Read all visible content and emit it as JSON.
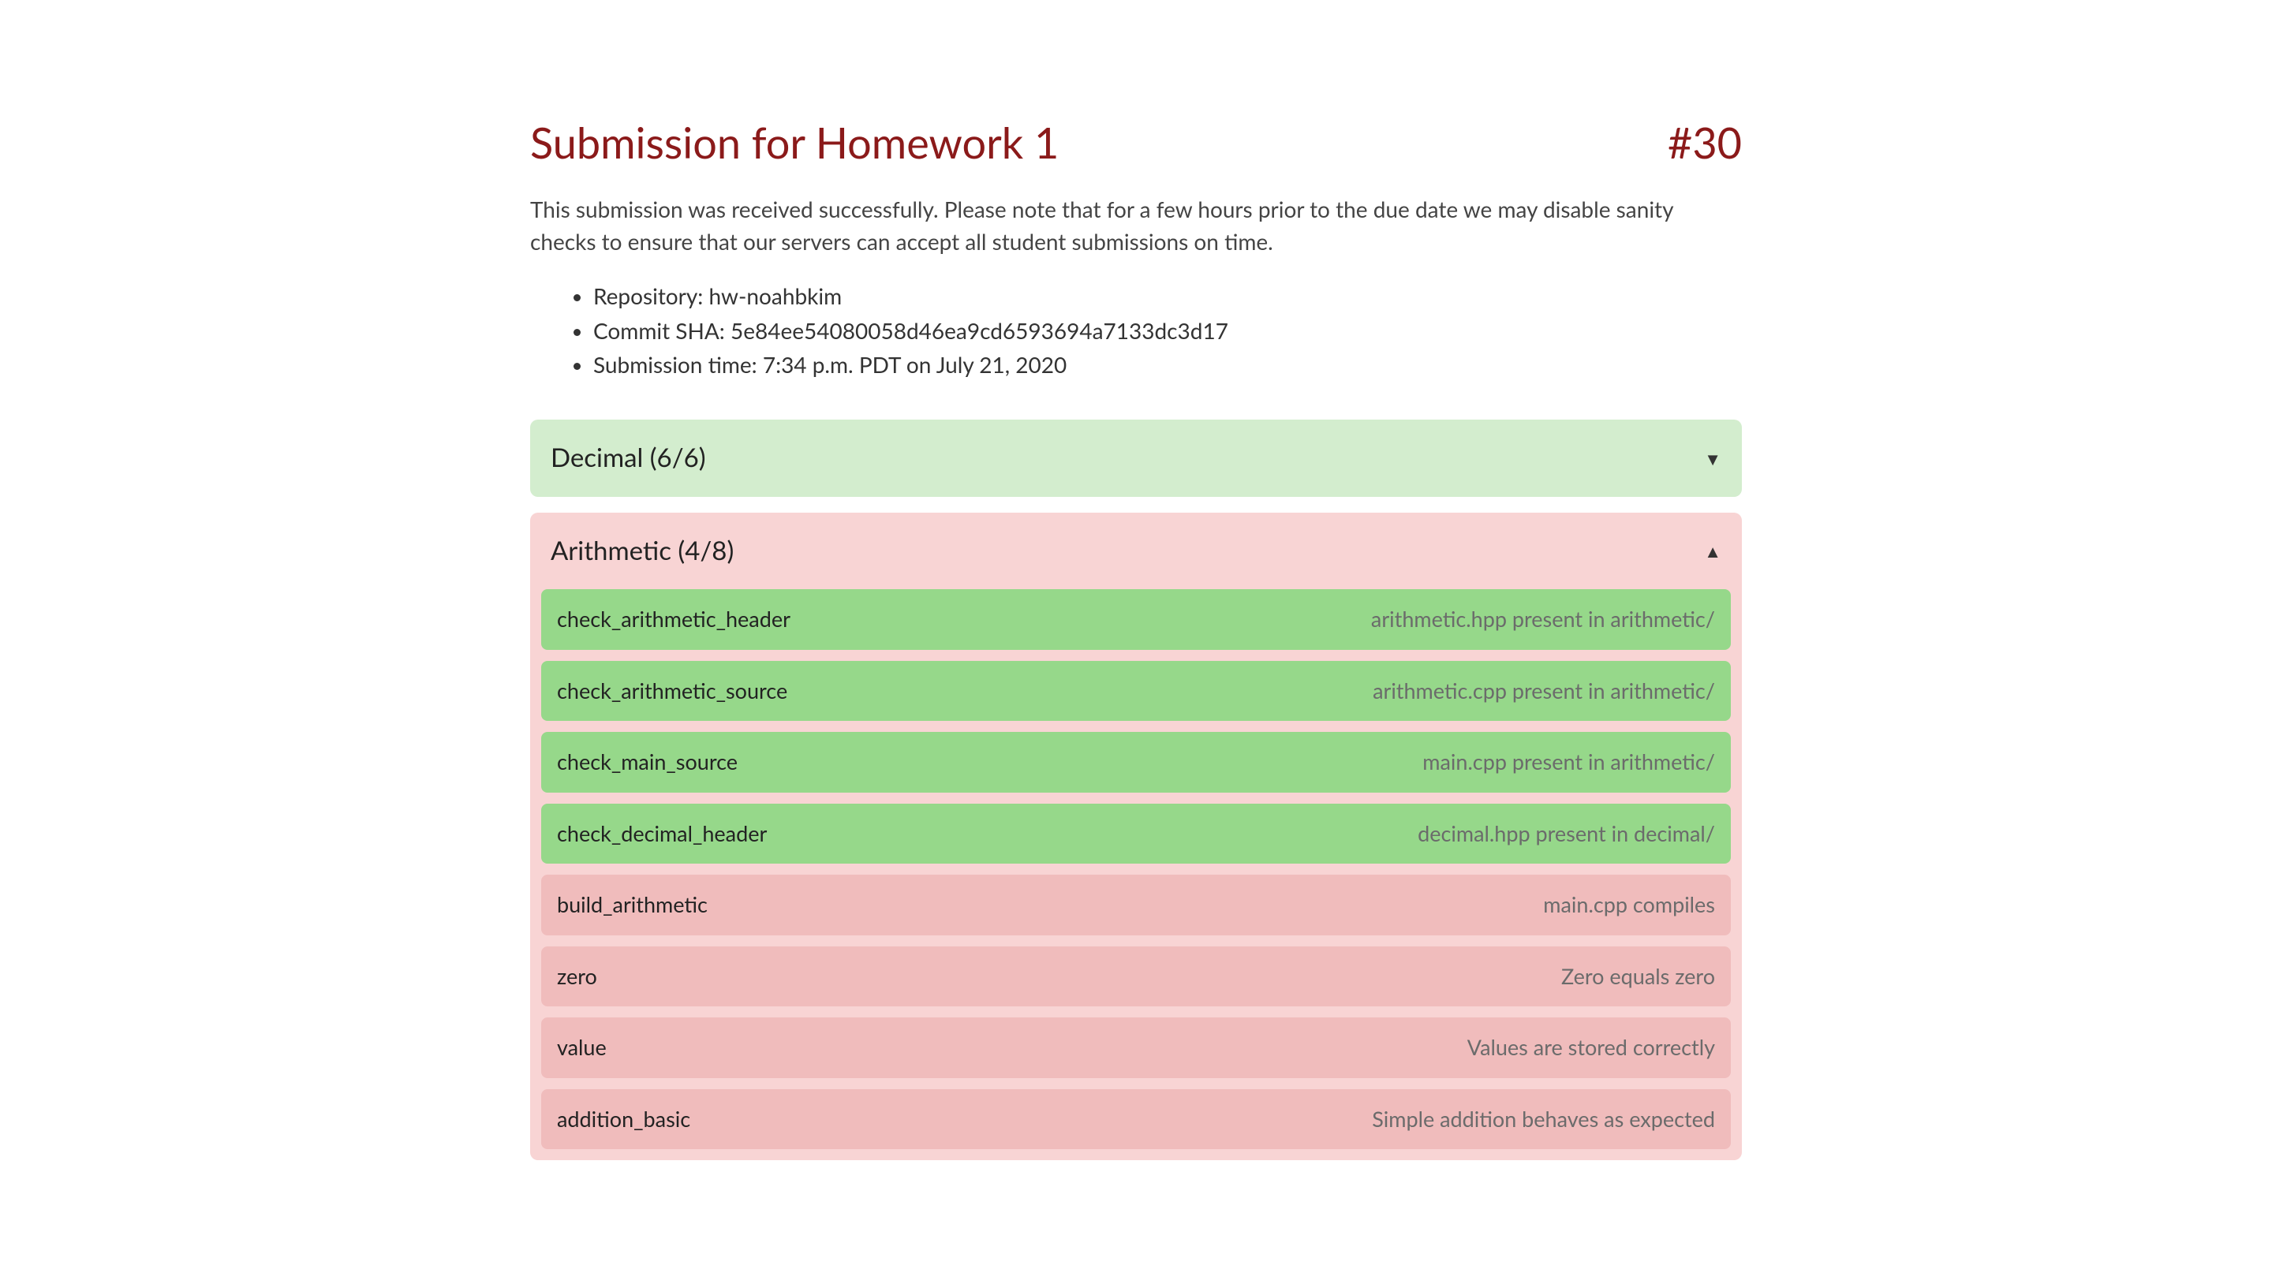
{
  "header": {
    "title": "Submission for Homework 1",
    "number": "#30"
  },
  "description": "This submission was received successfully. Please note that for a few hours prior to the due date we may disable sanity checks to ensure that our servers can accept all student submissions on time.",
  "metadata": {
    "repository_label": "Repository:",
    "repository_value": "hw-noahbkim",
    "commit_label": "Commit SHA:",
    "commit_value": "5e84ee54080058d46ea9cd6593694a7133dc3d17",
    "time_label": "Submission time:",
    "time_value": "7:34 p.m. PDT on July 21, 2020"
  },
  "sections": [
    {
      "title": "Decimal (6/6)",
      "status": "pass",
      "expanded": false,
      "chevron": "▼"
    },
    {
      "title": "Arithmetic (4/8)",
      "status": "fail",
      "expanded": true,
      "chevron": "▲",
      "tests": [
        {
          "name": "check_arithmetic_header",
          "desc": "arithmetic.hpp present in arithmetic/",
          "status": "pass"
        },
        {
          "name": "check_arithmetic_source",
          "desc": "arithmetic.cpp present in arithmetic/",
          "status": "pass"
        },
        {
          "name": "check_main_source",
          "desc": "main.cpp present in arithmetic/",
          "status": "pass"
        },
        {
          "name": "check_decimal_header",
          "desc": "decimal.hpp present in decimal/",
          "status": "pass"
        },
        {
          "name": "build_arithmetic",
          "desc": "main.cpp compiles",
          "status": "fail"
        },
        {
          "name": "zero",
          "desc": "Zero equals zero",
          "status": "fail"
        },
        {
          "name": "value",
          "desc": "Values are stored correctly",
          "status": "fail"
        },
        {
          "name": "addition_basic",
          "desc": "Simple addition behaves as expected",
          "status": "fail"
        }
      ]
    }
  ]
}
